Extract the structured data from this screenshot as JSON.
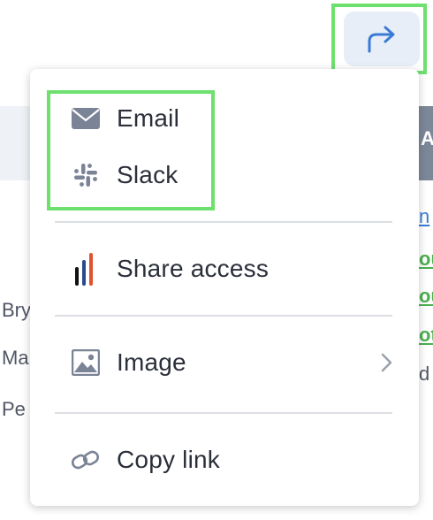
{
  "background": {
    "left_fragments": [
      "Bry",
      "Ma",
      "Pe"
    ],
    "right_header_fragment": "AT",
    "right_link_fragment": "n",
    "right_green_fragments": [
      "ou",
      "ou",
      "ot"
    ],
    "right_gray_fragment": "d"
  },
  "share_button": {
    "icon": "share-arrow-icon"
  },
  "menu": {
    "items": [
      {
        "label": "Email",
        "icon": "envelope-icon"
      },
      {
        "label": "Slack",
        "icon": "slack-icon"
      },
      {
        "label": "Share access",
        "icon": "share-access-bars-icon"
      },
      {
        "label": "Image",
        "icon": "image-icon",
        "has_submenu": true
      },
      {
        "label": "Copy link",
        "icon": "link-icon"
      }
    ]
  },
  "colors": {
    "highlight": "#6ee06e",
    "share_button_bg": "#e8eef8",
    "share_arrow": "#3a7bd5",
    "icon_gray": "#7a8496",
    "green_text": "#4caf50",
    "link_blue": "#3a7bd5"
  }
}
